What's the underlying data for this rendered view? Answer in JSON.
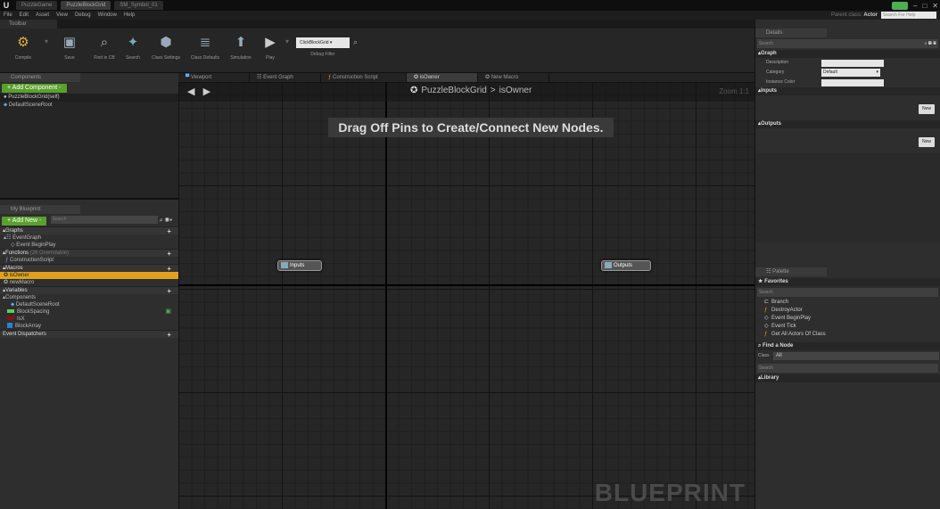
{
  "titlebar": {
    "tabs": [
      "PuzzleGame",
      "PuzzleBlockGrid",
      "SM_Symbol_01"
    ],
    "search_help_placeholder": "Search For Help"
  },
  "menu": [
    "File",
    "Edit",
    "Asset",
    "View",
    "Debug",
    "Window",
    "Help"
  ],
  "parent_class": {
    "label": "Parent class:",
    "value": "Actor"
  },
  "toolbar": {
    "header": "Toolbar",
    "buttons": [
      {
        "label": "Compile",
        "icon": "compile-icon"
      },
      {
        "label": "Save",
        "icon": "save-icon"
      },
      {
        "label": "Find in CB",
        "icon": "find-in-cb-icon"
      },
      {
        "label": "Search",
        "icon": "search-icon"
      },
      {
        "label": "Class Settings",
        "icon": "class-settings-icon"
      },
      {
        "label": "Class Defaults",
        "icon": "class-defaults-icon"
      },
      {
        "label": "Simulation",
        "icon": "simulation-icon"
      },
      {
        "label": "Play",
        "icon": "play-icon"
      }
    ],
    "debug_object": "ClickBlockGrid",
    "debug_filter_label": "Debug Filter"
  },
  "components": {
    "tab": "Components",
    "add_button": "+ Add Component -",
    "self_row": "PuzzleBlockGrid(self)",
    "root": "DefaultSceneRoot"
  },
  "my_blueprint": {
    "tab": "My Blueprint",
    "add_new": "+ Add New -",
    "search_placeholder": "Search",
    "graphs_header": "Graphs",
    "event_graph": "EventGraph",
    "event_begin_play": "Event BeginPlay",
    "functions_header": "Functions",
    "functions_note": "(26 Overridable)",
    "construction_script": "ConstructionScript",
    "macros_header": "Macros",
    "macro_is_owner": "isOwner",
    "macro_new": "newMacro",
    "variables_header": "Variables",
    "components_header": "Components",
    "var_default_scene_root": "DefaultSceneRoot",
    "var_block_spacing": "BlockSpacing",
    "var_is_x": "IsX",
    "var_block_array": "BlockArray",
    "event_dispatchers_header": "Event Dispatchers",
    "colors": {
      "selected": "#e0a21c",
      "int_var": "#5ad15a",
      "bool_var": "#8b1010",
      "array_var": "#2a7fd4"
    }
  },
  "graph_tabs": [
    "Viewport",
    "Event Graph",
    "Construction Script",
    "isOwner",
    "New Macro"
  ],
  "graph": {
    "breadcrumb_root": "PuzzleBlockGrid",
    "breadcrumb_sep": ">",
    "breadcrumb_current": "isOwner",
    "zoom": "Zoom 1:1",
    "hint": "Drag Off Pins to Create/Connect New Nodes.",
    "node_inputs": "Inputs",
    "node_outputs": "Outputs",
    "watermark": "BLUEPRINT"
  },
  "details": {
    "tab": "Details",
    "search_placeholder": "Search",
    "graph_header": "Graph",
    "description_label": "Description",
    "category_label": "Category",
    "category_value": "Default",
    "instance_color_label": "Instance Color",
    "inputs_header": "Inputs",
    "outputs_header": "Outputs",
    "new_label": "New"
  },
  "palette": {
    "tab": "Palette",
    "favorites_header": "Favorites",
    "search_placeholder": "Search",
    "items": [
      "Branch",
      "DestroyActor",
      "Event BeginPlay",
      "Event Tick",
      "Get All Actors Of Class"
    ],
    "find_node": "Find a Node",
    "class_label": "Class",
    "class_value": "All",
    "library_header": "Library"
  }
}
